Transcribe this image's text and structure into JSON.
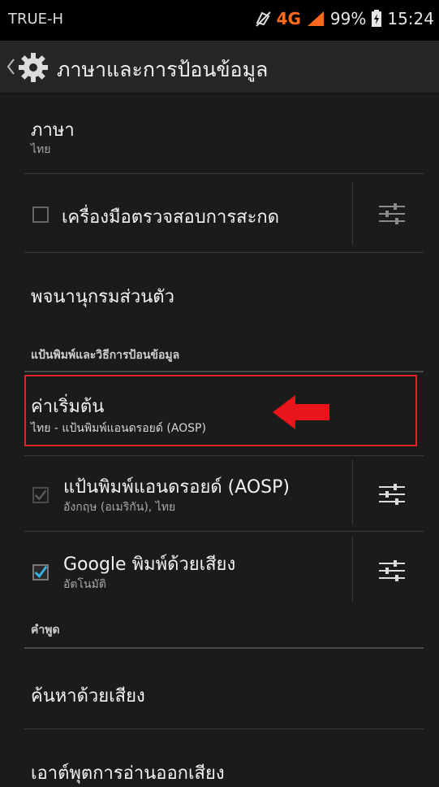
{
  "status_bar": {
    "carrier": "TRUE-H",
    "network": "4G",
    "battery": "99%",
    "time": "15:24"
  },
  "action_bar": {
    "title": "ภาษาและการป้อนข้อมูล",
    "icon": "settings-gear-icon"
  },
  "language": {
    "title": "ภาษา",
    "value": "ไทย"
  },
  "spell_checker": {
    "label": "เครื่องมือตรวจสอบการสะกด",
    "checked": false
  },
  "personal_dictionary": {
    "label": "พจนานุกรมส่วนตัว"
  },
  "keyboard_section": {
    "header": "แป้นพิมพ์และวิธีการป้อนข้อมูล",
    "default": {
      "title": "ค่าเริ่มต้น",
      "value": "ไทย - แป้นพิมพ์แอนดรอยด์ (AOSP)"
    },
    "aosp": {
      "title": "แป้นพิมพ์แอนดรอยด์ (AOSP)",
      "sub": "อังกฤษ (อเมริกัน), ไทย",
      "checked": true,
      "enabled": false
    },
    "google_voice": {
      "title": "Google พิมพ์ด้วยเสียง",
      "sub": "อัตโนมัติ",
      "checked": true
    }
  },
  "speech_section": {
    "header": "คำพูด",
    "voice_search": "ค้นหาด้วยเสียง",
    "tts_output": "เอาต์พุตการอ่านออกเสียง"
  },
  "colors": {
    "accent": "#33b5e5",
    "highlight": "#e0252a"
  }
}
